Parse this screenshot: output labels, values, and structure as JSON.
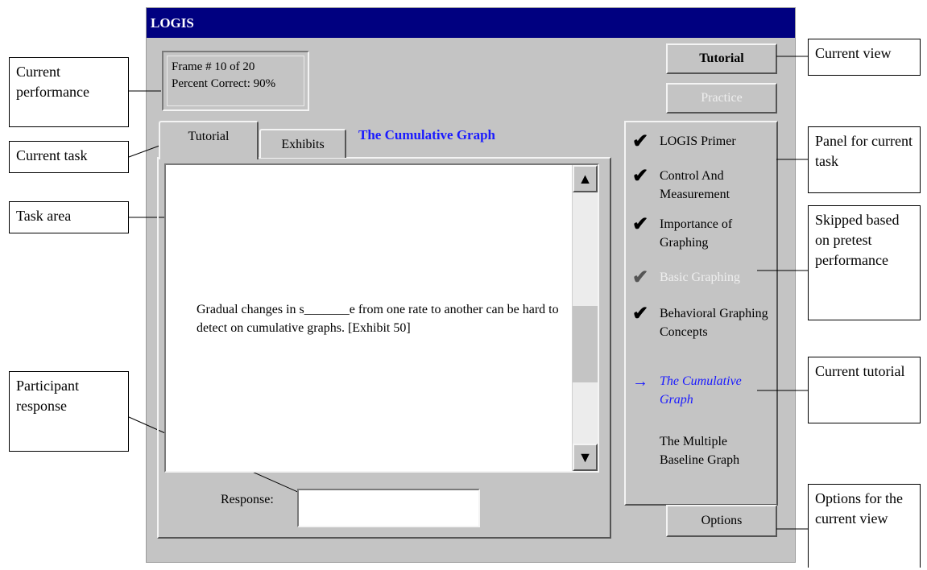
{
  "window": {
    "title": "LOGIS"
  },
  "performance": {
    "frame": "Frame # 10 of 20",
    "percent": "Percent Correct: 90%"
  },
  "buttons": {
    "tutorial": "Tutorial",
    "practice": "Practice",
    "options": "Options"
  },
  "tabs": [
    {
      "label": "Tutorial"
    },
    {
      "label": "Exhibits"
    }
  ],
  "tab_title": "The Cumulative Graph",
  "task": {
    "text": "Gradual changes in s_______e from one rate to another can be hard to detect on cumulative graphs. [Exhibit 50]"
  },
  "scrollbar": {
    "up": "▲",
    "down": "▼"
  },
  "response": {
    "label": "Response:",
    "value": ""
  },
  "lessons": [
    {
      "label": "LOGIS Primer",
      "status": "done",
      "icon": "✔"
    },
    {
      "label": "Control And Measurement",
      "status": "done",
      "icon": "✔"
    },
    {
      "label": "Importance of Graphing",
      "status": "done",
      "icon": "✔"
    },
    {
      "label": "Basic Graphing",
      "status": "skipped",
      "icon": "✔"
    },
    {
      "label": "Behavioral Graphing Concepts",
      "status": "done",
      "icon": "✔"
    },
    {
      "label": "The Cumulative Graph",
      "status": "current",
      "icon": "→"
    },
    {
      "label": "The Multiple Baseline Graph",
      "status": "pending",
      "icon": ""
    }
  ],
  "annotations": {
    "current_performance": "Current performance",
    "current_task": "Current task",
    "task_area": "Task area",
    "participant_response": "Participant response",
    "current_view": "Current view",
    "panel_current_task": "Panel for current task",
    "skipped": "Skipped based on pretest performance",
    "current_tutorial": "Current tutorial",
    "options_view": "Options for the current view"
  },
  "colors": {
    "titlebar": "#000080",
    "window": "#c4c4c4",
    "accent": "#1a1aff",
    "disabled": "#eeeeee"
  }
}
